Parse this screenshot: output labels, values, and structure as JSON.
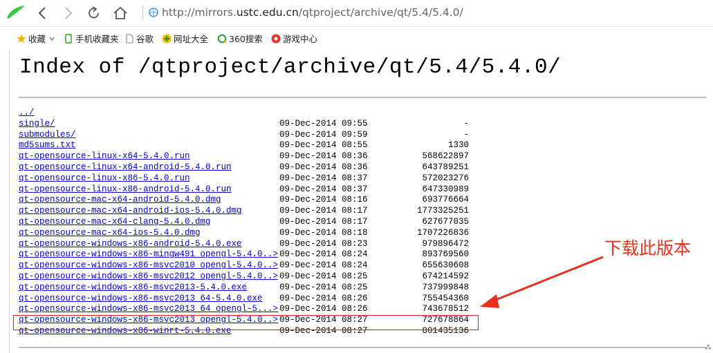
{
  "browser": {
    "address": {
      "prefix": "http://mirrors.",
      "host": "ustc.edu.cn",
      "path": "/qtproject/archive/qt/5.4/5.4.0/"
    },
    "bookmarks": [
      {
        "label": "收藏",
        "icon": "star-icon",
        "color": "#f5b400"
      },
      {
        "label": "手机收藏夹",
        "icon": "phone-icon",
        "color": "#2a9d2a"
      },
      {
        "label": "谷歌",
        "icon": "page-icon",
        "color": "#888888"
      },
      {
        "label": "网址大全",
        "icon": "site-guide-icon",
        "color": "#2a8d1a"
      },
      {
        "label": "360搜索",
        "icon": "search360-icon",
        "color": "#23a23a"
      },
      {
        "label": "游戏中心",
        "icon": "game-icon",
        "color": "#e0352a"
      }
    ]
  },
  "page": {
    "title": "Index of /qtproject/archive/qt/5.4/5.4.0/",
    "entries": [
      {
        "name": "../",
        "date": "",
        "size": ""
      },
      {
        "name": "single/",
        "date": "09-Dec-2014 09:55",
        "size": "-"
      },
      {
        "name": "submodules/",
        "date": "09-Dec-2014 09:59",
        "size": "-"
      },
      {
        "name": "md5sums.txt",
        "date": "09-Dec-2014 08:55",
        "size": "1330"
      },
      {
        "name": "qt-opensource-linux-x64-5.4.0.run",
        "date": "09-Dec-2014 08:36",
        "size": "568622897"
      },
      {
        "name": "qt-opensource-linux-x64-android-5.4.0.run",
        "date": "09-Dec-2014 08:36",
        "size": "643789251"
      },
      {
        "name": "qt-opensource-linux-x86-5.4.0.run",
        "date": "09-Dec-2014 08:37",
        "size": "572023276"
      },
      {
        "name": "qt-opensource-linux-x86-android-5.4.0.run",
        "date": "09-Dec-2014 08:37",
        "size": "647330989"
      },
      {
        "name": "qt-opensource-mac-x64-android-5.4.0.dmg",
        "date": "09-Dec-2014 08:16",
        "size": "693776664"
      },
      {
        "name": "qt-opensource-mac-x64-android-ios-5.4.0.dmg",
        "date": "09-Dec-2014 08:17",
        "size": "1773325251"
      },
      {
        "name": "qt-opensource-mac-x64-clang-5.4.0.dmg",
        "date": "09-Dec-2014 08:17",
        "size": "627677035"
      },
      {
        "name": "qt-opensource-mac-x64-ios-5.4.0.dmg",
        "date": "09-Dec-2014 08:18",
        "size": "1707226836"
      },
      {
        "name": "qt-opensource-windows-x86-android-5.4.0.exe",
        "date": "09-Dec-2014 08:23",
        "size": "979896472"
      },
      {
        "name": "qt-opensource-windows-x86-mingw491_opengl-5.4.0..>",
        "date": "09-Dec-2014 08:24",
        "size": "893769560"
      },
      {
        "name": "qt-opensource-windows-x86-msvc2010_opengl-5.4.0..>",
        "date": "09-Dec-2014 08:24",
        "size": "655630608"
      },
      {
        "name": "qt-opensource-windows-x86-msvc2012_opengl-5.4.0..>",
        "date": "09-Dec-2014 08:25",
        "size": "674214592"
      },
      {
        "name": "qt-opensource-windows-x86-msvc2013-5.4.0.exe",
        "date": "09-Dec-2014 08:25",
        "size": "737999848"
      },
      {
        "name": "qt-opensource-windows-x86-msvc2013_64-5.4.0.exe",
        "date": "09-Dec-2014 08:26",
        "size": "755454360"
      },
      {
        "name": "qt-opensource-windows-x86-msvc2013_64_opengl-5...>",
        "date": "09-Dec-2014 08:26",
        "size": "743678512"
      },
      {
        "name": "qt-opensource-windows-x86-msvc2013_opengl-5.4.0..>",
        "date": "09-Dec-2014 08:27",
        "size": "727678864"
      },
      {
        "name": "qt-opensource-windows-x86-winrt-5.4.0.exe",
        "date": "09-Dec-2014 08:27",
        "size": "801435136"
      }
    ]
  },
  "annotation": {
    "text": "下载此版本",
    "color": "#e83020"
  }
}
